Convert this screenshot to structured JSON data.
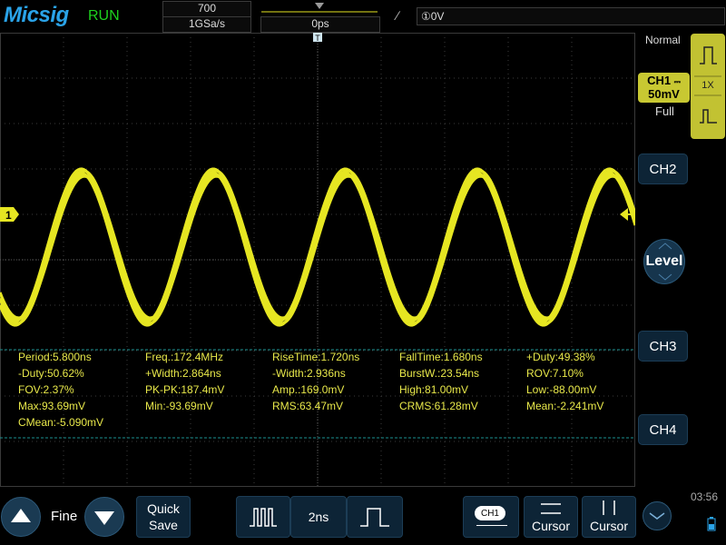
{
  "header": {
    "brand": "Micsig",
    "run_status": "RUN",
    "memory_depth": "700",
    "sample_rate": "1GSa/s",
    "horizontal_delay": "0ps",
    "trigger_level": "①0V"
  },
  "channel1": {
    "marker_label": "1",
    "tag_name": "CH1",
    "scale": "50mV",
    "probe_ratio": "1X",
    "acquire_mode": "Normal",
    "bandwidth": "Full",
    "color": "#e6e622"
  },
  "right_panel": {
    "ch2_label": "CH2",
    "ch3_label": "CH3",
    "ch4_label": "CH4",
    "level_label": "Level"
  },
  "measurements": [
    [
      "Period:5.800ns",
      "Freq.:172.4MHz",
      "RiseTime:1.720ns",
      "FallTime:1.680ns",
      "+Duty:49.38%"
    ],
    [
      "-Duty:50.62%",
      "+Width:2.864ns",
      "-Width:2.936ns",
      "BurstW.:23.54ns",
      "ROV:7.10%"
    ],
    [
      "FOV:2.37%",
      "PK-PK:187.4mV",
      "Amp.:169.0mV",
      "High:81.00mV",
      "Low:-88.00mV"
    ],
    [
      "Max:93.69mV",
      "Min:-93.69mV",
      "RMS:63.47mV",
      "CRMS:61.28mV",
      "Mean:-2.241mV"
    ],
    [
      "CMean:-5.090mV"
    ]
  ],
  "bottom_bar": {
    "fine_label": "Fine",
    "quick_save_line1": "Quick",
    "quick_save_line2": "Save",
    "timebase": "2ns",
    "ch1_badge": "CH1",
    "cursor1_label": "Cursor",
    "cursor2_label": "Cursor",
    "clock": "03:56"
  },
  "icons": {
    "up": "up-arrow-icon",
    "down": "down-arrow-icon",
    "pulse_wide": "pulse-wide-icon",
    "pulse_narrow": "pulse-narrow-icon",
    "chevron": "chevron-down-icon",
    "battery": "battery-icon"
  }
}
